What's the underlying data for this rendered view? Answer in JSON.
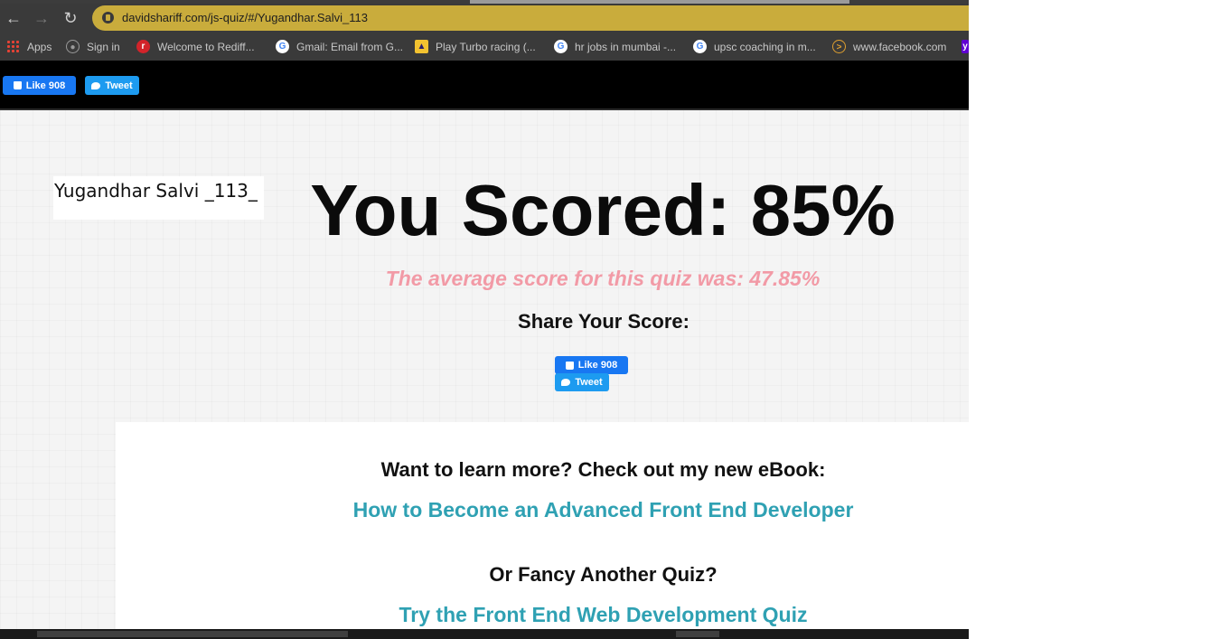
{
  "browser": {
    "url": "davidshariff.com/js-quiz/#/Yugandhar.Salvi_113",
    "bookmarks": [
      {
        "label": "Apps",
        "icon": "apps-grid-icon"
      },
      {
        "label": "Sign in",
        "icon": "person-icon"
      },
      {
        "label": "Welcome to Rediff...",
        "icon": "rediff-icon"
      },
      {
        "label": "Gmail: Email from G...",
        "icon": "google-icon"
      },
      {
        "label": "Play Turbo racing (...",
        "icon": "turbo-icon"
      },
      {
        "label": "hr jobs in mumbai -...",
        "icon": "google-icon"
      },
      {
        "label": "upsc coaching in m...",
        "icon": "google-icon"
      },
      {
        "label": "www.facebook.com",
        "icon": "facebook-icon"
      }
    ],
    "yahoo_icon_text": "y"
  },
  "social": {
    "like_label": "Like 908",
    "tweet_label": "Tweet"
  },
  "result": {
    "username": "Yugandhar Salvi _113_",
    "score_text": "You Scored: 85%",
    "average_text": "The average score for this quiz was: 47.85%",
    "share_title": "Share Your Score:"
  },
  "promo": {
    "learn_more": "Want to learn more? Check out my new eBook:",
    "ebook_link": "How to Become an Advanced Front End Developer",
    "another_quiz": "Or Fancy Another Quiz?",
    "quiz_link": "Try the Front End Web Development Quiz"
  },
  "colors": {
    "omnibox": "#c9ac3c",
    "facebook_blue": "#1877f2",
    "twitter_blue": "#1d9bf0",
    "average_pink": "#f29aa6",
    "link_teal": "#2fa1b3"
  }
}
